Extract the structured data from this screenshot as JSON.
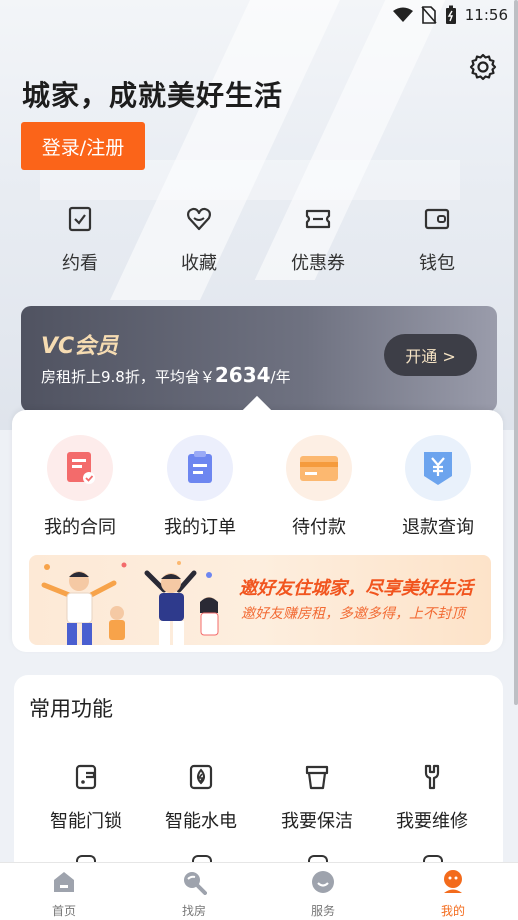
{
  "status": {
    "time": "11:56"
  },
  "hero": {
    "title": "城家，成就美好生活",
    "login_label": "登录/注册"
  },
  "quick": [
    {
      "label": "约看",
      "icon": "calendar-check-icon"
    },
    {
      "label": "收藏",
      "icon": "heart-icon"
    },
    {
      "label": "优惠券",
      "icon": "coupon-icon"
    },
    {
      "label": "钱包",
      "icon": "wallet-icon"
    }
  ],
  "vip": {
    "title": "VC会员",
    "desc_prefix": "房租折上9.8折，平均省￥",
    "amount": "2634",
    "unit": "/年",
    "button": "开通 >"
  },
  "orders": [
    {
      "label": "我的合同",
      "icon": "contract-icon"
    },
    {
      "label": "我的订单",
      "icon": "order-icon"
    },
    {
      "label": "待付款",
      "icon": "card-icon"
    },
    {
      "label": "退款查询",
      "icon": "refund-icon"
    }
  ],
  "banner": {
    "title": "邀好友住城家，尽享美好生活",
    "subtitle": "邀好友赚房租，多邀多得，上不封顶"
  },
  "common": {
    "title": "常用功能",
    "items": [
      {
        "label": "智能门锁",
        "icon": "smart-lock-icon"
      },
      {
        "label": "智能水电",
        "icon": "utility-icon"
      },
      {
        "label": "我要保洁",
        "icon": "cleaning-icon"
      },
      {
        "label": "我要维修",
        "icon": "repair-icon"
      }
    ]
  },
  "tabs": [
    {
      "label": "首页",
      "icon": "home-icon"
    },
    {
      "label": "找房",
      "icon": "search-house-icon"
    },
    {
      "label": "服务",
      "icon": "service-icon"
    },
    {
      "label": "我的",
      "icon": "profile-icon",
      "active": true
    }
  ],
  "colors": {
    "accent": "#fb6419",
    "vip_gold": "#f6dcb2",
    "tab_active": "#f36b1c"
  }
}
